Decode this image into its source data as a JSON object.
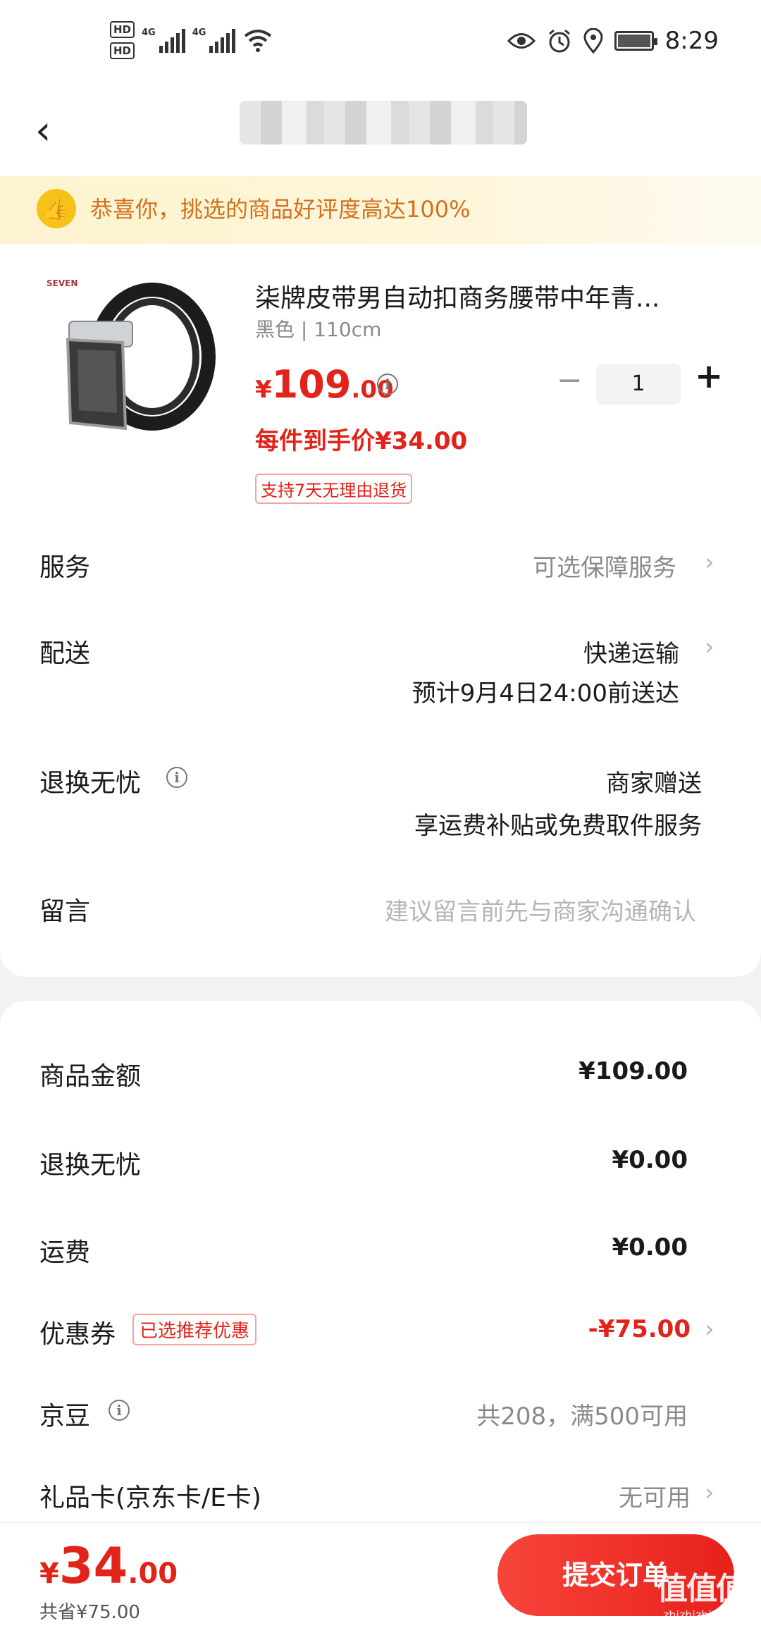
{
  "status_bar": {
    "hd1": "HD",
    "hd2": "HD",
    "net1": "4G",
    "net2": "4G",
    "time": "8:29"
  },
  "nav": {
    "back_icon": "chevron-left-icon"
  },
  "banner": {
    "text": "恭喜你，挑选的商品好评度高达100%"
  },
  "product": {
    "title": "柒牌皮带男自动扣商务腰带中年青...",
    "spec": "黑色 | 110cm",
    "price_currency": "¥",
    "price_int": "109",
    "price_dec": ".00",
    "quantity": "1",
    "minus_label": "−",
    "plus_label": "+",
    "unit_price": "每件到手价¥34.00",
    "return_tag": "支持7天无理由退货"
  },
  "rows": {
    "service_label": "服务",
    "service_value": "可选保障服务",
    "delivery_label": "配送",
    "delivery_value": "快递运输",
    "delivery_eta": "预计9月4日24:00前送达",
    "worry_free_label": "退换无忧",
    "worry_free_value": "商家赠送",
    "worry_free_desc": "享运费补贴或免费取件服务",
    "message_label": "留言",
    "message_placeholder": "建议留言前先与商家沟通确认"
  },
  "summary": {
    "goods_amount_label": "商品金额",
    "goods_amount_value": "¥109.00",
    "worry_free_label": "退换无忧",
    "worry_free_value": "¥0.00",
    "shipping_label": "运费",
    "shipping_value": "¥0.00",
    "coupon_label": "优惠券",
    "coupon_badge": "已选推荐优惠",
    "coupon_value": "-¥75.00",
    "beans_label": "京豆",
    "beans_value": "共208，满500可用",
    "gift_card_label": "礼品卡(京东卡/E卡)",
    "gift_card_value": "无可用"
  },
  "footer": {
    "total_currency": "¥",
    "total_int": "34",
    "total_dec": ".00",
    "saved": "共省¥75.00",
    "submit_label": "提交订单",
    "watermark": "值值值",
    "watermark_sub": "zhizhizhi.com"
  },
  "colors": {
    "accent_red": "#e2231a",
    "banner_text": "#d2711e",
    "banner_bg": "#fdf3cf"
  }
}
